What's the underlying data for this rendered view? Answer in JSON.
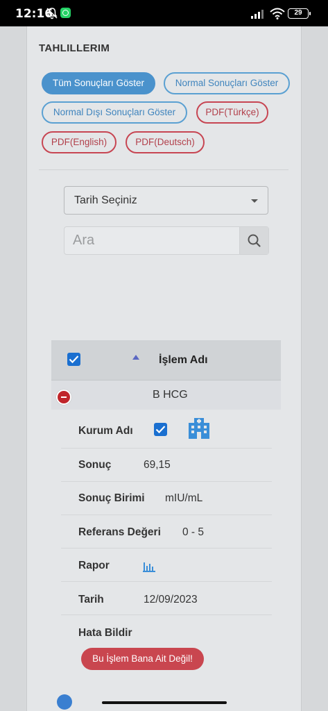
{
  "status_bar": {
    "time": "12:16",
    "battery": "29"
  },
  "page": {
    "title": "TAHLILLERIM"
  },
  "filters": [
    {
      "label": "Tüm Sonuçları Göster",
      "style": "active"
    },
    {
      "label": "Normal Sonuçları Göster",
      "style": "blue"
    },
    {
      "label": "Normal Dışı Sonuçları Göster",
      "style": "blue"
    },
    {
      "label": "PDF(Türkçe)",
      "style": "red"
    },
    {
      "label": "PDF(English)",
      "style": "red"
    },
    {
      "label": "PDF(Deutsch)",
      "style": "red"
    }
  ],
  "date_select": {
    "value": "Tarih Seçiniz"
  },
  "search": {
    "placeholder": "Ara"
  },
  "table": {
    "column_title": "İşlem Adı",
    "row_name": "B HCG",
    "details": {
      "institution_label": "Kurum Adı",
      "result_label": "Sonuç",
      "result_value": "69,15",
      "unit_label": "Sonuç Birimi",
      "unit_value": "mIU/mL",
      "reference_label": "Referans Değeri",
      "reference_value": "0 - 5",
      "report_label": "Rapor",
      "date_label": "Tarih",
      "date_value": "12/09/2023",
      "report_error_label": "Hata Bildir"
    },
    "not_mine_button": "Bu İşlem Bana Ait Değil!"
  },
  "colors": {
    "primary": "#4a92cc",
    "danger": "#c9464f",
    "checkbox": "#1a6fd0",
    "hospital_icon": "#3a8ed8"
  }
}
